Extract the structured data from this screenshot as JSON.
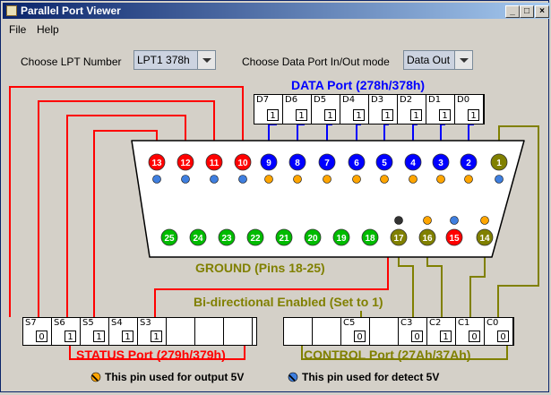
{
  "window": {
    "title": "Parallel Port Viewer"
  },
  "menu": {
    "file": "File",
    "help": "Help"
  },
  "controls": {
    "lpt_label": "Choose LPT Number",
    "lpt_value": "LPT1  378h",
    "mode_label": "Choose Data Port In/Out mode",
    "mode_value": "Data Out"
  },
  "data_port": {
    "title": "DATA Port (278h/378h)",
    "bits": [
      {
        "name": "D7",
        "value": "1"
      },
      {
        "name": "D6",
        "value": "1"
      },
      {
        "name": "D5",
        "value": "1"
      },
      {
        "name": "D4",
        "value": "1"
      },
      {
        "name": "D3",
        "value": "1"
      },
      {
        "name": "D2",
        "value": "1"
      },
      {
        "name": "D1",
        "value": "1"
      },
      {
        "name": "D0",
        "value": "1"
      }
    ]
  },
  "status_port": {
    "title": "STATUS Port (279h/379h)",
    "bits": [
      {
        "name": "S7",
        "value": "0"
      },
      {
        "name": "S6",
        "value": "1"
      },
      {
        "name": "S5",
        "value": "1"
      },
      {
        "name": "S4",
        "value": "1"
      },
      {
        "name": "S3",
        "value": "1"
      },
      {
        "name": "",
        "value": ""
      },
      {
        "name": "",
        "value": ""
      },
      {
        "name": "",
        "value": ""
      }
    ]
  },
  "control_port": {
    "title": "CONTROL Port (27Ah/37Ah)",
    "bits": [
      {
        "name": "",
        "value": ""
      },
      {
        "name": "",
        "value": ""
      },
      {
        "name": "C5",
        "value": "0"
      },
      {
        "name": "",
        "value": ""
      },
      {
        "name": "C3",
        "value": "0"
      },
      {
        "name": "C2",
        "value": "1"
      },
      {
        "name": "C1",
        "value": "0"
      },
      {
        "name": "C0",
        "value": "0"
      }
    ]
  },
  "connector": {
    "top_pins": [
      {
        "label": "13",
        "color": "#ff0000"
      },
      {
        "label": "12",
        "color": "#ff0000"
      },
      {
        "label": "11",
        "color": "#ff0000"
      },
      {
        "label": "10",
        "color": "#ff0000"
      },
      {
        "label": "9",
        "color": "#0000ff"
      },
      {
        "label": "8",
        "color": "#0000ff"
      },
      {
        "label": "7",
        "color": "#0000ff"
      },
      {
        "label": "6",
        "color": "#0000ff"
      },
      {
        "label": "5",
        "color": "#0000ff"
      },
      {
        "label": "4",
        "color": "#0000ff"
      },
      {
        "label": "3",
        "color": "#0000ff"
      },
      {
        "label": "2",
        "color": "#0000ff"
      },
      {
        "label": "1",
        "color": "#808000"
      }
    ],
    "ground_pins": [
      "25",
      "24",
      "23",
      "22",
      "21",
      "20",
      "19",
      "18"
    ],
    "control_pins": [
      {
        "label": "17",
        "color": "#808000"
      },
      {
        "label": "16",
        "color": "#808000"
      },
      {
        "label": "15",
        "color": "#ff0000"
      },
      {
        "label": "14",
        "color": "#808000"
      }
    ],
    "ground_label": "GROUND (Pins 18-25)",
    "bidir_label": "Bi-directional Enabled (Set to 1)"
  },
  "colors": {
    "data": "#0000ff",
    "status": "#ff0000",
    "control": "#808000",
    "ground": "#00bb00"
  },
  "legend": {
    "output": "This pin used for output 5V",
    "detect": "This pin used for detect 5V"
  }
}
